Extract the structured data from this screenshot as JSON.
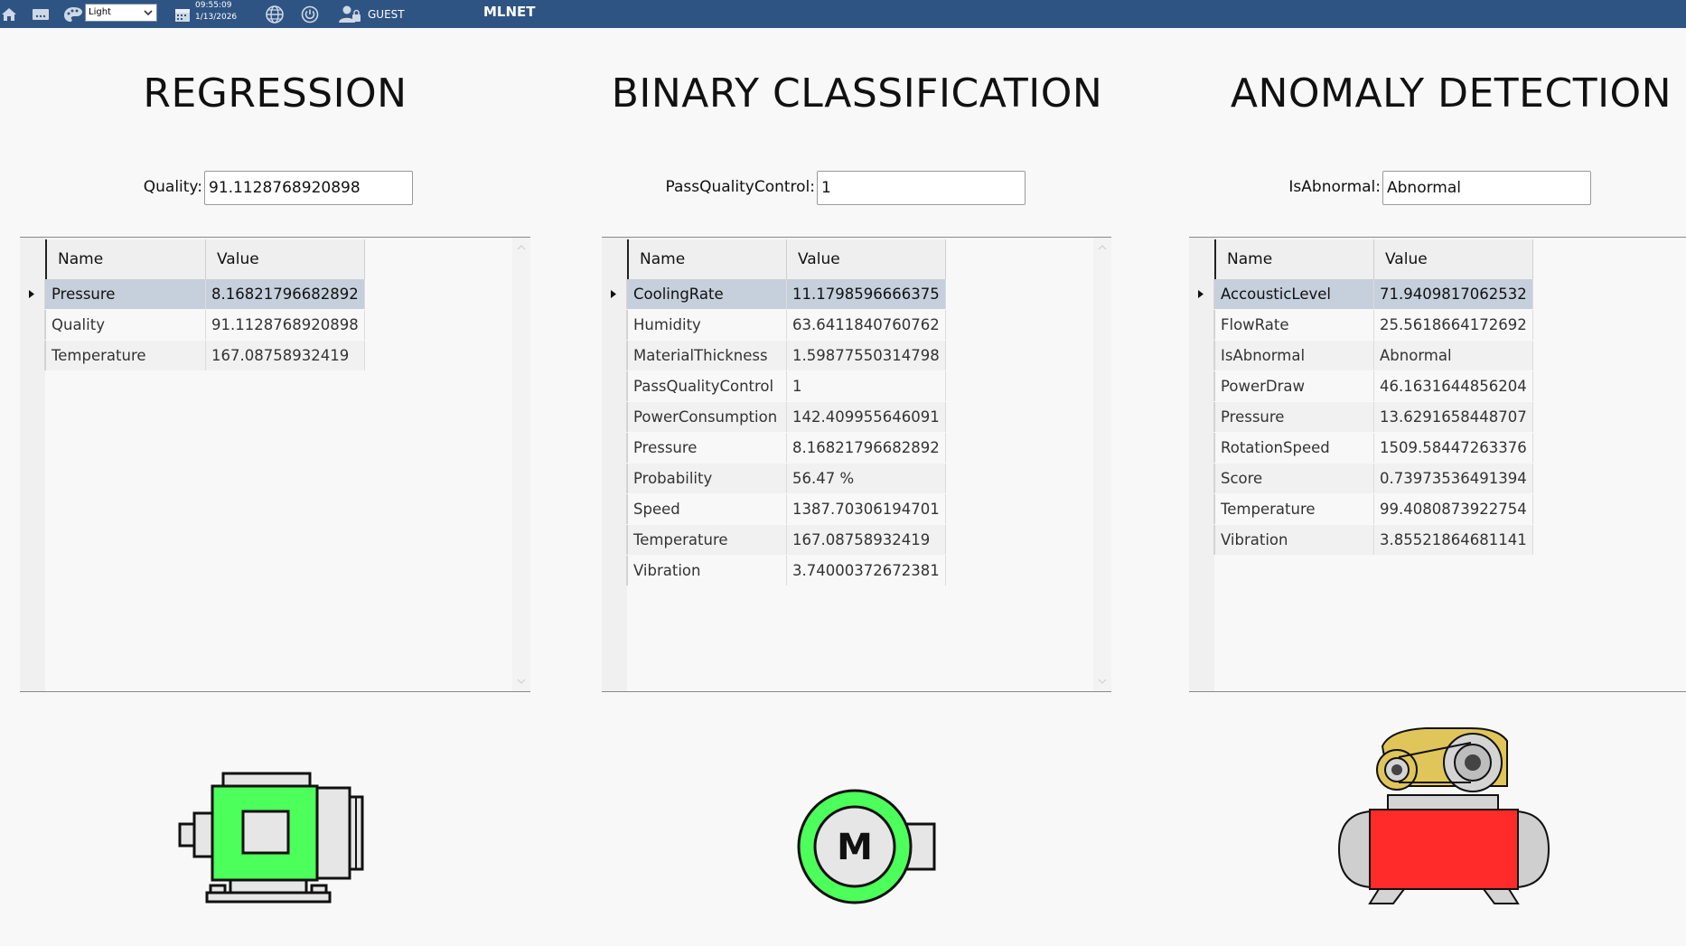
{
  "topbar": {
    "theme_value": "Light",
    "time": "09:55:09",
    "date": "1/13/2026",
    "user": "GUEST",
    "app_title": "MLNET"
  },
  "regression": {
    "title": "REGRESSION",
    "field_label": "Quality:",
    "field_value": "91.1128768920898",
    "columns": [
      "Name",
      "Value"
    ],
    "rows": [
      {
        "name": "Pressure",
        "value": "8.16821796682892",
        "selected": true
      },
      {
        "name": "Quality",
        "value": "91.1128768920898"
      },
      {
        "name": "Temperature",
        "value": "167.08758932419"
      }
    ]
  },
  "binary": {
    "title": "BINARY CLASSIFICATION",
    "field_label": "PassQualityControl:",
    "field_value": "1",
    "columns": [
      "Name",
      "Value"
    ],
    "rows": [
      {
        "name": "CoolingRate",
        "value": "11.1798596666375",
        "selected": true
      },
      {
        "name": "Humidity",
        "value": "63.6411840760762"
      },
      {
        "name": "MaterialThickness",
        "value": "1.59877550314798"
      },
      {
        "name": "PassQualityControl",
        "value": "1"
      },
      {
        "name": "PowerConsumption",
        "value": "142.409955646091"
      },
      {
        "name": "Pressure",
        "value": "8.16821796682892"
      },
      {
        "name": "Probability",
        "value": "56.47 %"
      },
      {
        "name": "Speed",
        "value": "1387.70306194701"
      },
      {
        "name": "Temperature",
        "value": "167.08758932419"
      },
      {
        "name": "Vibration",
        "value": "3.74000372672381"
      }
    ],
    "motor_label": "M"
  },
  "anomaly": {
    "title": "ANOMALY DETECTION",
    "field_label": "IsAbnormal:",
    "field_value": "Abnormal",
    "columns": [
      "Name",
      "Value"
    ],
    "rows": [
      {
        "name": "AccousticLevel",
        "value": "71.9409817062532",
        "selected": true
      },
      {
        "name": "FlowRate",
        "value": "25.5618664172692"
      },
      {
        "name": "IsAbnormal",
        "value": "Abnormal"
      },
      {
        "name": "PowerDraw",
        "value": "46.1631644856204"
      },
      {
        "name": "Pressure",
        "value": "13.6291658448707"
      },
      {
        "name": "RotationSpeed",
        "value": "1509.58447263376"
      },
      {
        "name": "Score",
        "value": "0.73973536491394"
      },
      {
        "name": "Temperature",
        "value": "99.4080873922754"
      },
      {
        "name": "Vibration",
        "value": "3.85521864681141"
      }
    ]
  },
  "colors": {
    "topbar": "#2e5483",
    "motor_green": "#4cff5a",
    "compressor_red": "#ff2a2a",
    "selected_row": "#c6cfdc"
  }
}
